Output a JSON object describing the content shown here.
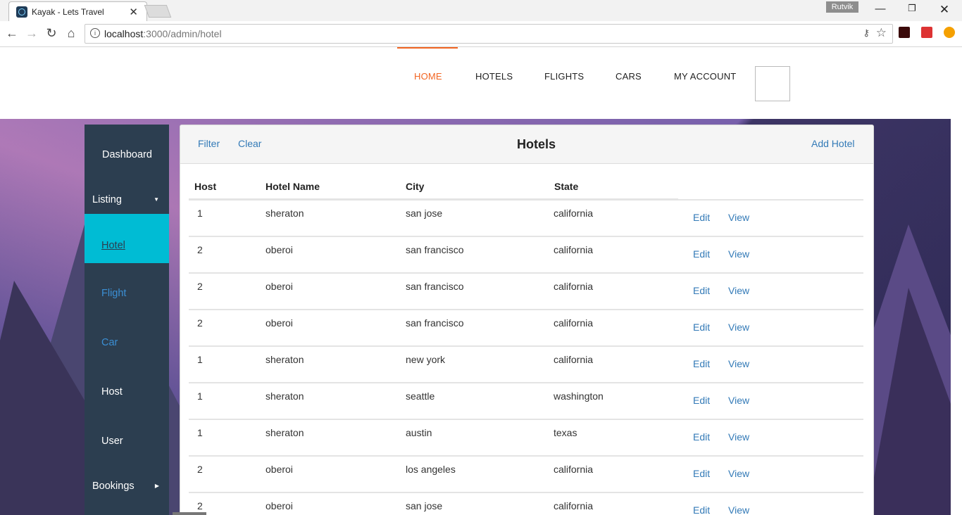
{
  "browser": {
    "tab_title": "Kayak - Lets Travel",
    "profile_name": "Rutvik",
    "url_host": "localhost",
    "url_rest": ":3000/admin/hotel"
  },
  "topnav": {
    "items": [
      "HOME",
      "HOTELS",
      "FLIGHTS",
      "CARS",
      "MY ACCOUNT"
    ],
    "active": "HOME",
    "accent_color": "#f26522"
  },
  "sidebar": {
    "items": [
      {
        "label": "Dashboard"
      },
      {
        "label": "Listing",
        "icon": "caret-down-icon"
      },
      {
        "label": "Hotel",
        "active": true
      },
      {
        "label": "Flight"
      },
      {
        "label": "Car"
      },
      {
        "label": "Host"
      },
      {
        "label": "User"
      },
      {
        "label": "Bookings",
        "icon": "caret-right-icon"
      }
    ],
    "bg_color": "#2c3e50",
    "active_color": "#00bcd4"
  },
  "panel": {
    "filter_label": "Filter",
    "clear_label": "Clear",
    "title": "Hotels",
    "add_label": "Add Hotel"
  },
  "table": {
    "headers": [
      "Host",
      "Hotel Name",
      "City",
      "State"
    ],
    "edit_label": "Edit",
    "view_label": "View",
    "rows": [
      {
        "host": "1",
        "name": "sheraton",
        "city": "san jose",
        "state": "california"
      },
      {
        "host": "2",
        "name": "oberoi",
        "city": "san francisco",
        "state": "california"
      },
      {
        "host": "2",
        "name": "oberoi",
        "city": "san francisco",
        "state": "california"
      },
      {
        "host": "2",
        "name": "oberoi",
        "city": "san francisco",
        "state": "california"
      },
      {
        "host": "1",
        "name": "sheraton",
        "city": "new york",
        "state": "california"
      },
      {
        "host": "1",
        "name": "sheraton",
        "city": "seattle",
        "state": "washington"
      },
      {
        "host": "1",
        "name": "sheraton",
        "city": "austin",
        "state": "texas"
      },
      {
        "host": "2",
        "name": "oberoi",
        "city": "los angeles",
        "state": "california"
      },
      {
        "host": "2",
        "name": "oberoi",
        "city": "san jose",
        "state": "california"
      }
    ]
  }
}
